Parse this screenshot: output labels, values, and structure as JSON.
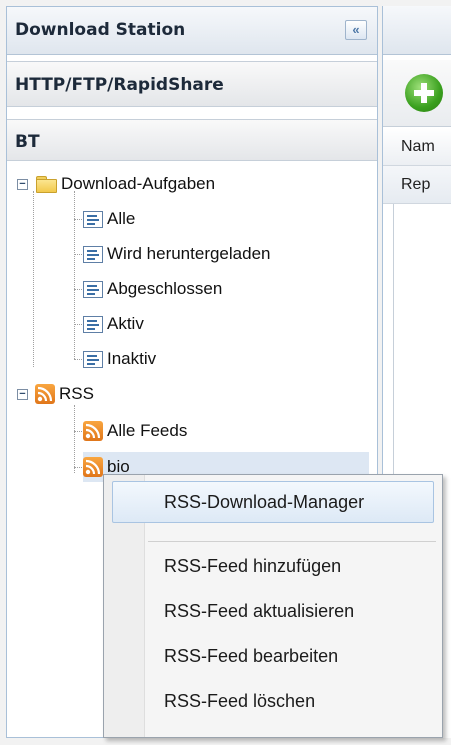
{
  "panel": {
    "title": "Download Station",
    "collapse_glyph": "«",
    "sections": {
      "http": "HTTP/FTP/RapidShare",
      "bt": "BT"
    }
  },
  "tree": {
    "download_tasks": {
      "label": "Download-Aufgaben",
      "icon": "folder-icon",
      "children": [
        "Alle",
        "Wird heruntergeladen",
        "Abgeschlossen",
        "Aktiv",
        "Inaktiv"
      ]
    },
    "rss": {
      "label": "RSS",
      "icon": "rss-icon",
      "children": [
        "Alle Feeds",
        "bio"
      ]
    }
  },
  "right_panel": {
    "add_icon": "add-circle-icon",
    "column_header": "Nam",
    "row_text": "Rep"
  },
  "context_menu": {
    "items": [
      "RSS-Download-Manager",
      "RSS-Feed hinzufügen",
      "RSS-Feed aktualisieren",
      "RSS-Feed bearbeiten",
      "RSS-Feed löschen"
    ]
  },
  "colors": {
    "accent_blue": "#4f79a8",
    "rss_orange": "#e0761a",
    "add_green": "#3aa01e",
    "selection": "#dde7f3"
  }
}
